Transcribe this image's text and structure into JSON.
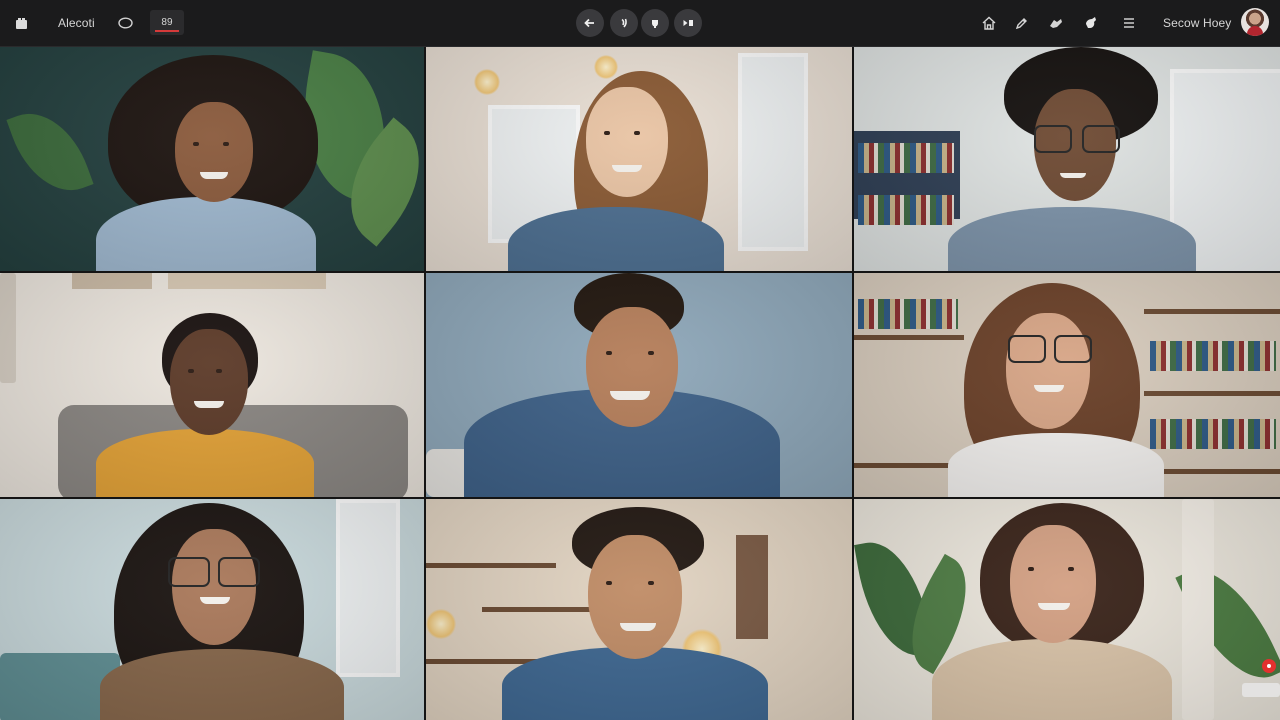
{
  "app": {
    "title": "Alecoti",
    "recording_label": "89",
    "user_name": "Secow Hoey"
  },
  "center_controls": [
    {
      "name": "back-icon",
      "glyph": "←"
    },
    {
      "name": "mic-icon",
      "glyph": "♪"
    },
    {
      "name": "camera-icon",
      "glyph": "◉"
    },
    {
      "name": "share-icon",
      "glyph": "▶"
    }
  ],
  "right_icons": [
    {
      "name": "home-icon",
      "glyph": "⌂"
    },
    {
      "name": "pen-icon",
      "glyph": "✎"
    },
    {
      "name": "reaction-icon",
      "glyph": "✋"
    },
    {
      "name": "hand-icon",
      "glyph": "✊"
    },
    {
      "name": "menu-icon",
      "glyph": "≡"
    }
  ],
  "participants": [
    {
      "bg": "#2b4c4a",
      "skin": "#8a5a3c",
      "hair": "#1d1410",
      "shirt": "#9fb8cf"
    },
    {
      "bg": "#e8ddd2",
      "skin": "#e9c4a4",
      "hair": "#8a5a34",
      "shirt": "#4d6f91"
    },
    {
      "bg": "#dfe2e0",
      "skin": "#6e4a33",
      "hair": "#15110f",
      "shirt": "#7d93a9"
    },
    {
      "bg": "#ece6de",
      "skin": "#5c3a28",
      "hair": "#1a1210",
      "shirt": "#e3a237"
    },
    {
      "bg": "#8fa8ba",
      "skin": "#b57e5a",
      "hair": "#22170f",
      "shirt": "#3e6188"
    },
    {
      "bg": "#d8ccbd",
      "skin": "#d7a586",
      "hair": "#6a4028",
      "shirt": "#f2f0ee"
    },
    {
      "bg": "#c9d9dc",
      "skin": "#a9785a",
      "hair": "#1b1411",
      "shirt": "#86664a"
    },
    {
      "bg": "#e2d4c2",
      "skin": "#c08c66",
      "hair": "#231913",
      "shirt": "#3e6791"
    },
    {
      "bg": "#ebe6dc",
      "skin": "#d3a083",
      "hair": "#3a241a",
      "shirt": "#d9c3a8"
    }
  ]
}
